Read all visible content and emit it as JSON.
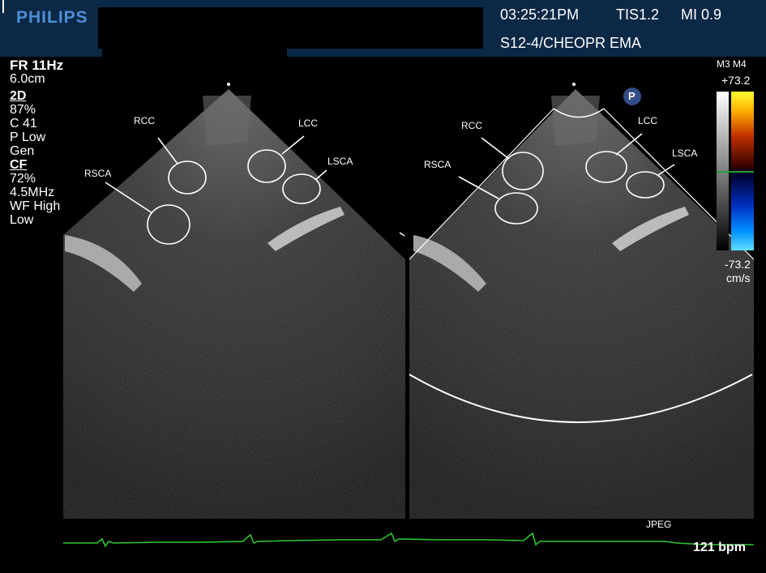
{
  "header": {
    "brand": "PHILIPS",
    "time": "03:25:21PM",
    "tis": "TIS1.2",
    "mi": "MI 0.9",
    "probe": "S12-4/CHEOPR EMA"
  },
  "left_panel": {
    "frame_rate": "FR 11Hz",
    "depth": "6.0cm",
    "mode_2d": "2D",
    "gain_2d": " 87%",
    "compress": "C 41",
    "power": "P Low",
    "gen": "Gen",
    "mode_cf": "CF",
    "gain_cf": " 72%",
    "freq": "4.5MHz",
    "wall_filter": "WF High",
    "low": "Low"
  },
  "color_bar": {
    "modes": "M3 M4",
    "max": "+73.2",
    "min": "-73.2",
    "unit": "cm/s"
  },
  "left_image_labels": {
    "rcc": "RCC",
    "lcc": "LCC",
    "lsca": "LSCA",
    "rsca": "RSCA"
  },
  "right_image_labels": {
    "rcc": "RCC",
    "lcc": "LCC",
    "lsca": "LSCA",
    "rsca": "RSCA"
  },
  "marker_p": "P",
  "footer": {
    "format": "JPEG",
    "heart_rate": "121 bpm"
  },
  "colors": {
    "header_bg": "#0b2846",
    "brand": "#4f8fd6",
    "ecg": "#2ec82e"
  }
}
